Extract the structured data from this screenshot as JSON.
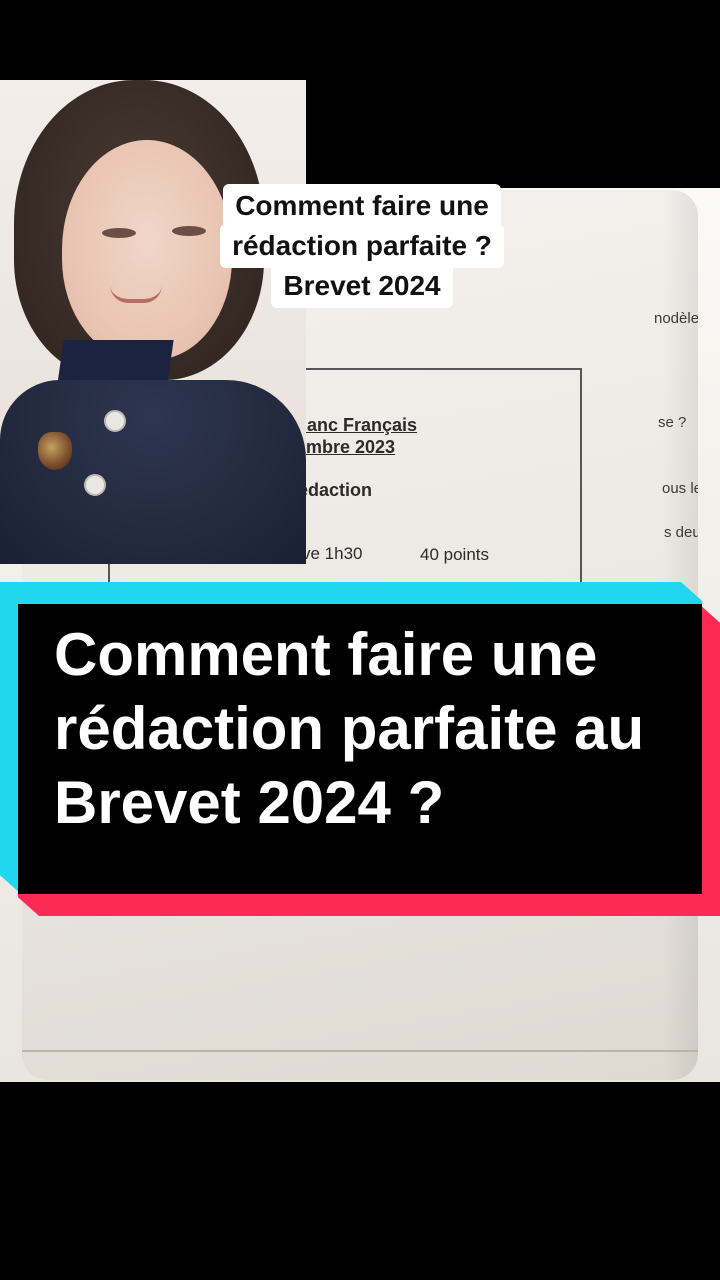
{
  "caption_top": {
    "line1": "Comment faire une",
    "line2": "rédaction parfaite ?",
    "line3": "Brevet 2024"
  },
  "banner": {
    "line1": "Comment faire une",
    "line2": "rédaction parfaite au",
    "line3": "Brevet 2024 ?"
  },
  "document": {
    "heading1": "lanc Français",
    "heading2": "mbre 2023",
    "section": "édaction",
    "duration": "ve 1h30",
    "points": "40 points",
    "side_texts": [
      "nodèle",
      "se ?",
      "ous le",
      "s deu"
    ]
  },
  "colors": {
    "banner_cyan": "#21d6ee",
    "banner_pink": "#fc2a55",
    "banner_fill": "#000000",
    "caption_bg": "#ffffff"
  }
}
